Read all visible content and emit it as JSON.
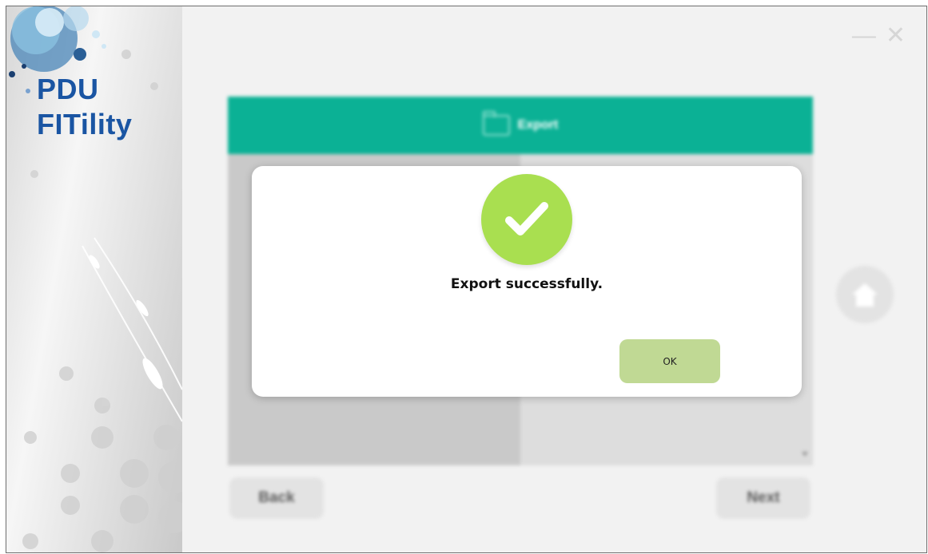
{
  "app": {
    "brand_line1": "PDU",
    "brand_line2": "FITility",
    "brand_color": "#1a55a3",
    "minimize_icon": "minimize-icon",
    "close_icon": "close-icon"
  },
  "page": {
    "header_title": "Export",
    "header_icon": "folder-icon",
    "header_color": "#0bb195",
    "back_label": "Back",
    "next_label": "Next",
    "home_icon": "home-icon"
  },
  "dialog": {
    "icon": "check-circle-icon",
    "icon_color": "#a9df50",
    "message": "Export successfully.",
    "ok_label": "OK",
    "ok_color": "#c0d994"
  }
}
